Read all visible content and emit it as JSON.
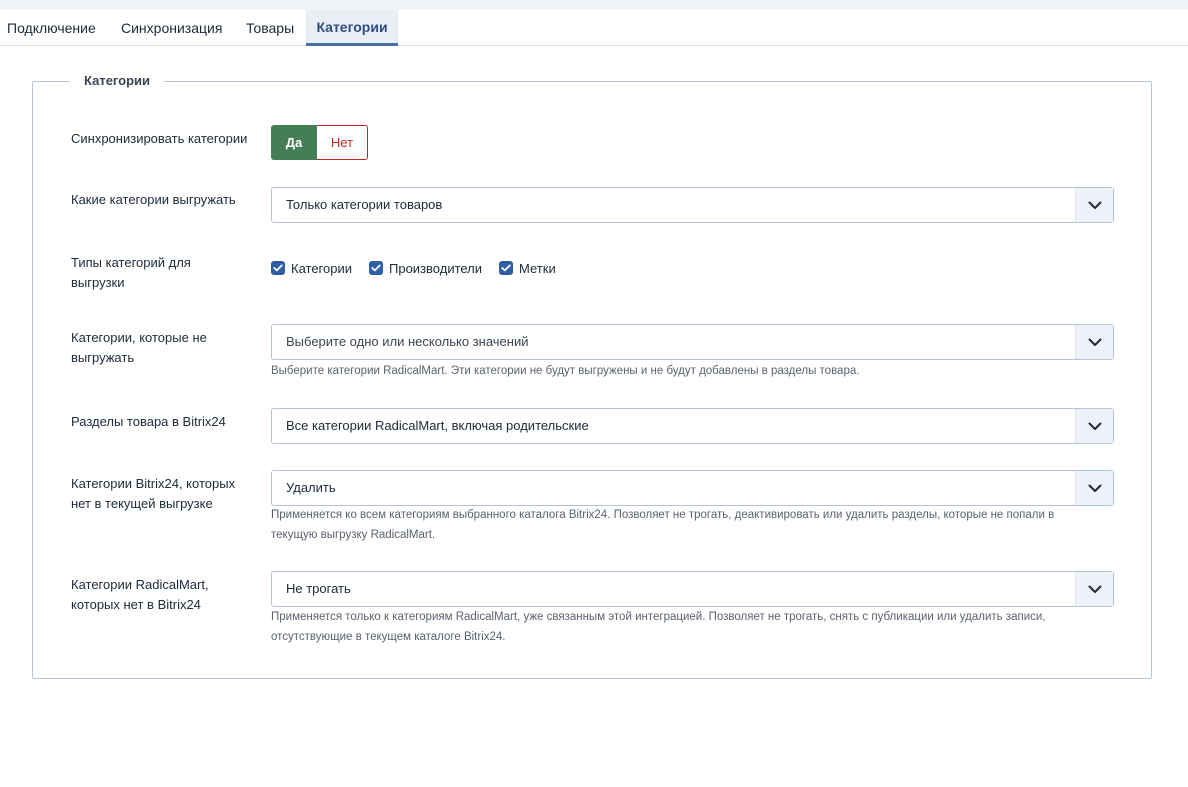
{
  "tabs": [
    {
      "label": "Подключение"
    },
    {
      "label": "Синхронизация"
    },
    {
      "label": "Товары"
    },
    {
      "label": "Категории",
      "active": true
    }
  ],
  "fieldset": {
    "legend": "Категории"
  },
  "fields": {
    "sync_categories": {
      "label": "Синхронизировать категории",
      "yes": "Да",
      "no": "Нет",
      "selected": "Да"
    },
    "which_categories": {
      "label": "Какие категории выгружать",
      "value": "Только категории товаров"
    },
    "category_types": {
      "label": "Типы категорий для выгрузки",
      "options": [
        {
          "label": "Категории",
          "checked": true
        },
        {
          "label": "Производители",
          "checked": true
        },
        {
          "label": "Метки",
          "checked": true
        }
      ]
    },
    "exclude_categories": {
      "label": "Категории, которые не выгружать",
      "placeholder": "Выберите одно или несколько значений",
      "description": "Выберите категории RadicalMart. Эти категории не будут выгружены и не будут добавлены в разделы товара."
    },
    "product_sections": {
      "label": "Разделы товара в Bitrix24",
      "value": "Все категории RadicalMart, включая родительские"
    },
    "bitrix_missing": {
      "label": "Категории Bitrix24, которых нет в текущей выгрузке",
      "value": "Удалить",
      "description": "Применяется ко всем категориям выбранного каталога Bitrix24. Позволяет не трогать, деактивировать или удалить разделы, которые не попали в текущую выгрузку RadicalMart."
    },
    "radical_missing": {
      "label": "Категории RadicalMart, которых нет в Bitrix24",
      "value": "Не трогать",
      "description": "Применяется только к категориям RadicalMart, уже связанным этой интеграцией. Позволяет не трогать, снять с публикации или удалить записи, отсутствующие в текущем каталоге Bitrix24."
    }
  },
  "colors": {
    "accent": "#4a6da5",
    "yes_active": "#457d54",
    "no_border": "#c52827",
    "checkbox": "#2e5fa6"
  }
}
